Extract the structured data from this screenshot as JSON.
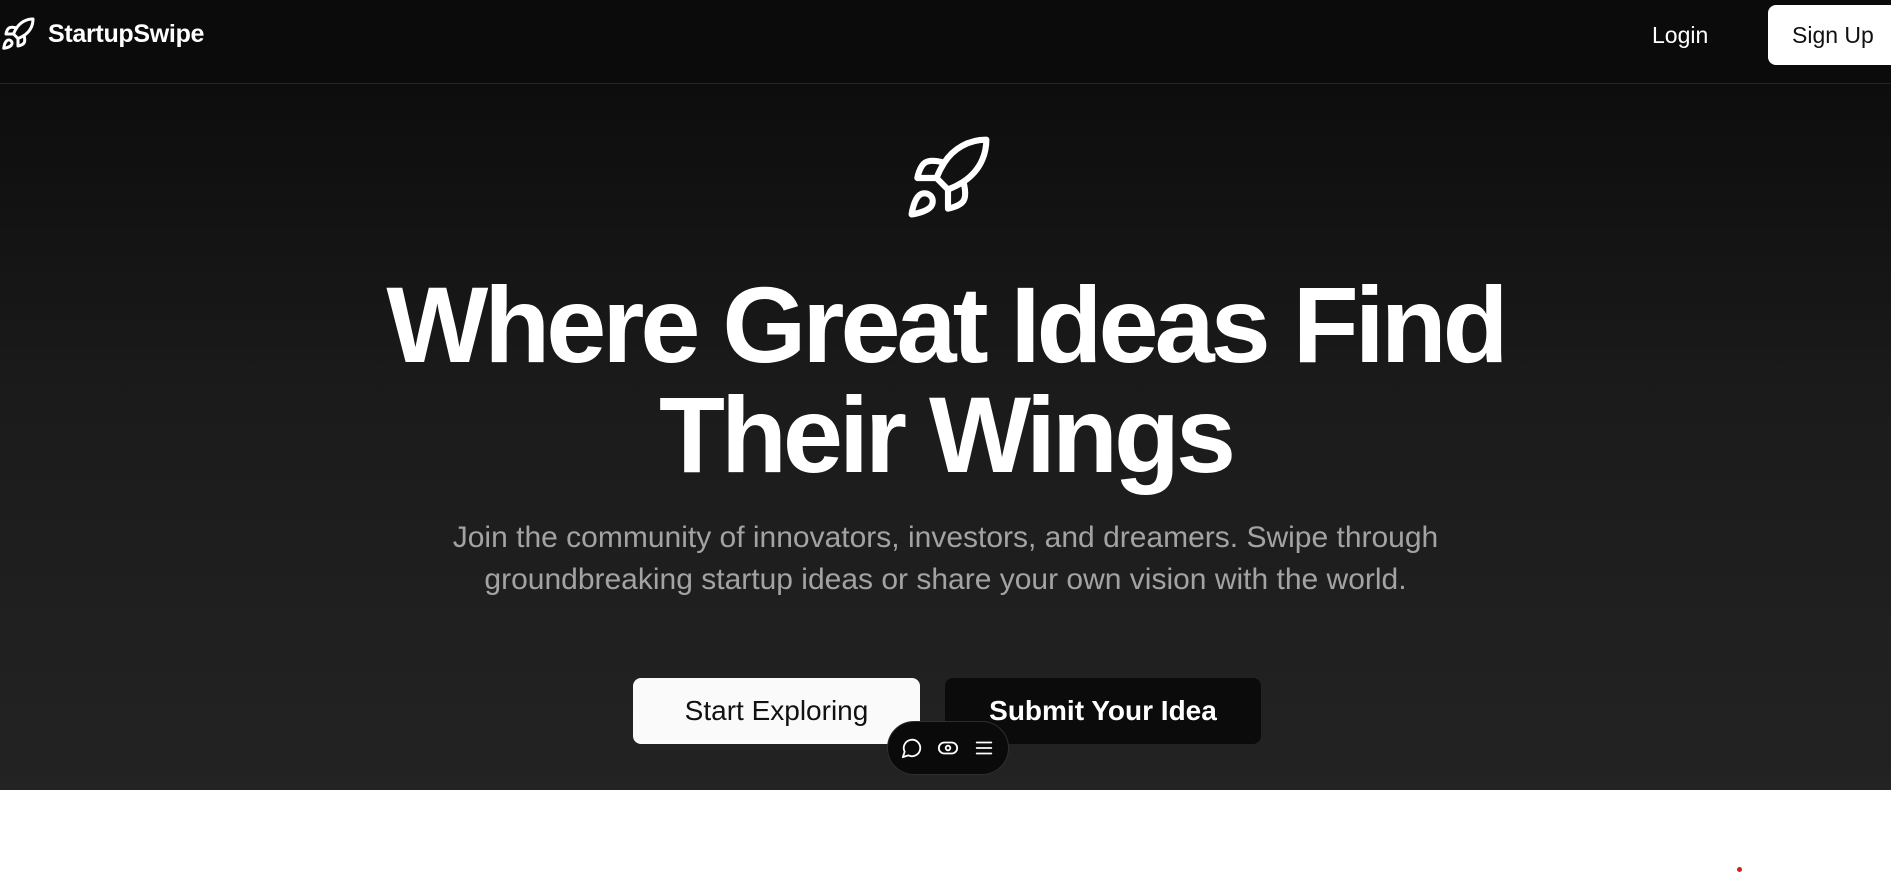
{
  "header": {
    "brand_name": "StartupSwipe",
    "brand_icon": "rocket-icon",
    "login_label": "Login",
    "signup_label": "Sign Up"
  },
  "hero": {
    "icon": "rocket-icon",
    "title_line1": "Where Great Ideas Find",
    "title_line2": "Their Wings",
    "subtitle": "Join the community of innovators, investors, and dreamers. Swipe through groundbreaking startup ideas or share your own vision with the world.",
    "primary_button_label": "Start Exploring",
    "secondary_button_label": "Submit Your Idea"
  },
  "floating_toolbar": {
    "icons": [
      "comment-icon",
      "eye-icon",
      "menu-icon"
    ]
  },
  "colors": {
    "header_bg": "#0b0b0b",
    "hero_gradient_top": "#0d0d0d",
    "hero_gradient_bottom": "#232323",
    "subtitle_text": "#a3a3a3",
    "button_light": "#fafafa",
    "button_dark": "#0b0b0b"
  }
}
